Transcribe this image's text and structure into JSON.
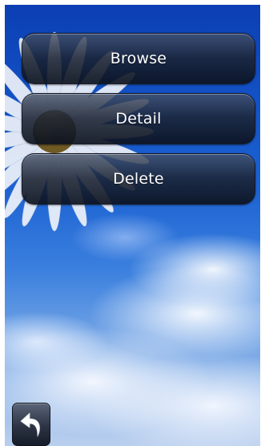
{
  "menu": {
    "items": [
      {
        "label": "Browse"
      },
      {
        "label": "Detail"
      },
      {
        "label": "Delete"
      }
    ]
  },
  "footer": {
    "back_icon": "back-arrow-icon"
  },
  "colors": {
    "sky_top": "#0b3fb3",
    "sky_bottom": "#b9cfee",
    "button_dark": "#1c2434",
    "text": "#ffffff",
    "flower_center": "#7a5a12"
  }
}
